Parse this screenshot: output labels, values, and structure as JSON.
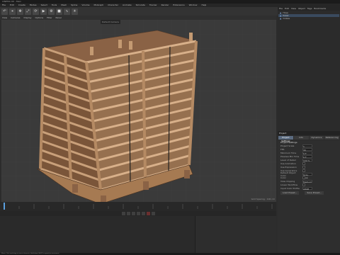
{
  "titlebar": {
    "title": "CINEMA 4D - Main"
  },
  "menu": [
    "File",
    "Edit",
    "Create",
    "Modes",
    "Select",
    "Tools",
    "Mesh",
    "Spline",
    "Volume",
    "MoGraph",
    "Character",
    "Animate",
    "Simulate",
    "Tracker",
    "Render",
    "Extensions",
    "Window",
    "Help"
  ],
  "viewport": {
    "camera_label": "Default Camera",
    "grid_spacing": "Grid Spacing : 100 cm",
    "menus": [
      "View",
      "Cameras",
      "Display",
      "Options",
      "Filter",
      "Panel"
    ]
  },
  "timeline": {
    "start": "0 F",
    "end": "90 F"
  },
  "objects": [
    {
      "name": "Hose",
      "selected": false
    },
    {
      "name": "Pallet",
      "selected": true
    },
    {
      "name": "Crates",
      "selected": false
    }
  ],
  "object_tabs": [
    "File",
    "Edit",
    "View",
    "Object",
    "Tags",
    "Bookmarks"
  ],
  "attributes": {
    "header": "Project",
    "tabs": [
      "Project Settings",
      "Info",
      "Dynamics",
      "Referencing"
    ],
    "section": "Project Settings",
    "rows": [
      {
        "label": "Project Scale",
        "value": "1"
      },
      {
        "label": "FPS",
        "value": "30"
      },
      {
        "label": "Minimum Time",
        "value": "0 F"
      },
      {
        "label": "Preview Min Time",
        "value": "0 F"
      },
      {
        "label": "Level of Detail",
        "value": "100 %"
      },
      {
        "label": "Use Animation",
        "value": ""
      },
      {
        "label": "Use Expression",
        "value": ""
      },
      {
        "label": "Use Generators",
        "value": ""
      },
      {
        "label": "Default Object Color",
        "value": "Gray Blue"
      },
      {
        "label": "Color",
        "value": ""
      },
      {
        "label": "View Clipping",
        "value": "Medium"
      },
      {
        "label": "Linear Workflow",
        "value": ""
      },
      {
        "label": "Input Color Profile",
        "value": "sRGB"
      }
    ],
    "buttons": [
      "Load Preset...",
      "Save Preset..."
    ]
  },
  "status": "Move: Click and drag to move elements. Hold down SHIFT to quantize movement."
}
